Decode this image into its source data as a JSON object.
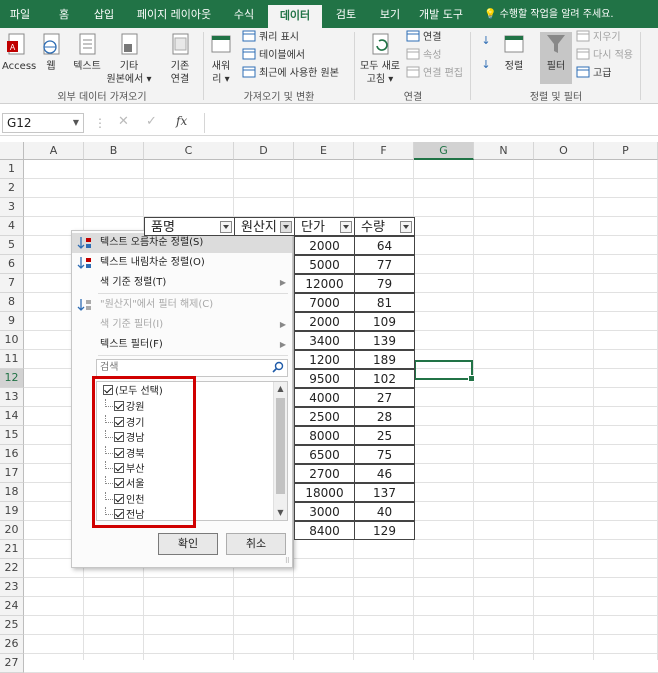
{
  "ribbon_tabs": [
    "파일",
    "홈",
    "삽입",
    "페이지 레이아웃",
    "수식",
    "데이터",
    "검토",
    "보기",
    "개발 도구"
  ],
  "active_tab": "데이터",
  "tell_me": "수행할 작업을 알려 주세요.",
  "ribbon": {
    "get_external": {
      "access": "Access",
      "web": "웹",
      "text": "텍스트",
      "other": "기타\n원본에서 ▾",
      "existing": "기존\n연결",
      "label": "외부 데이터 가져오기"
    },
    "get_transform": {
      "new_query": "새워\n리 ▾",
      "show_queries": "쿼리 표시",
      "from_table": "테이블에서",
      "recent": "최근에 사용한 원본",
      "label": "가져오기 및 변환"
    },
    "connections": {
      "refresh_all": "모두 새로\n고침 ▾",
      "connections": "연결",
      "properties": "속성",
      "edit_links": "연결 편집",
      "label": "연결"
    },
    "sort_filter": {
      "sort": "정렬",
      "filter": "필터",
      "clear": "지우기",
      "reapply": "다시 적용",
      "advanced": "고급",
      "label": "정렬 및 필터"
    }
  },
  "name_box": "G12",
  "fx_label": "fx",
  "columns": [
    "A",
    "B",
    "C",
    "D",
    "E",
    "F",
    "G",
    "N",
    "O",
    "P"
  ],
  "selected_column": "G",
  "rows": [
    "1",
    "2",
    "3",
    "4",
    "5",
    "6",
    "7",
    "8",
    "9",
    "10",
    "11",
    "12",
    "13",
    "14",
    "15",
    "16",
    "17",
    "18",
    "19",
    "20",
    "21",
    "22",
    "23",
    "24",
    "25",
    "26",
    "27"
  ],
  "selected_row": "12",
  "table": {
    "headers": [
      "품명",
      "원산지",
      "단가",
      "수량"
    ],
    "unit_price": [
      "2000",
      "5000",
      "12000",
      "7000",
      "2000",
      "3400",
      "1200",
      "9500",
      "4000",
      "2500",
      "8000",
      "6500",
      "2700",
      "18000",
      "3000",
      "8400"
    ],
    "quantity": [
      "64",
      "77",
      "79",
      "81",
      "109",
      "139",
      "189",
      "102",
      "27",
      "28",
      "25",
      "75",
      "46",
      "137",
      "40",
      "129"
    ]
  },
  "filter_menu": {
    "items": [
      {
        "label": "텍스트 오름차순 정렬(S)",
        "state": "hover",
        "icon": "sort-asc-icon"
      },
      {
        "label": "텍스트 내림차순 정렬(O)",
        "state": "normal",
        "icon": "sort-desc-icon"
      },
      {
        "label": "색 기준 정렬(T)",
        "state": "normal",
        "submenu": true
      },
      {
        "label": "\"원산지\"에서 필터 해제(C)",
        "state": "disabled",
        "icon": "clear-filter-icon"
      },
      {
        "label": "색 기준 필터(I)",
        "state": "disabled",
        "submenu": true
      },
      {
        "label": "텍스트 필터(F)",
        "state": "normal",
        "submenu": true
      }
    ],
    "search_placeholder": "검색",
    "list_items": [
      "(모두 선택)",
      "강원",
      "경기",
      "경남",
      "경북",
      "부산",
      "서울",
      "인천",
      "전남"
    ],
    "ok": "확인",
    "cancel": "취소"
  }
}
